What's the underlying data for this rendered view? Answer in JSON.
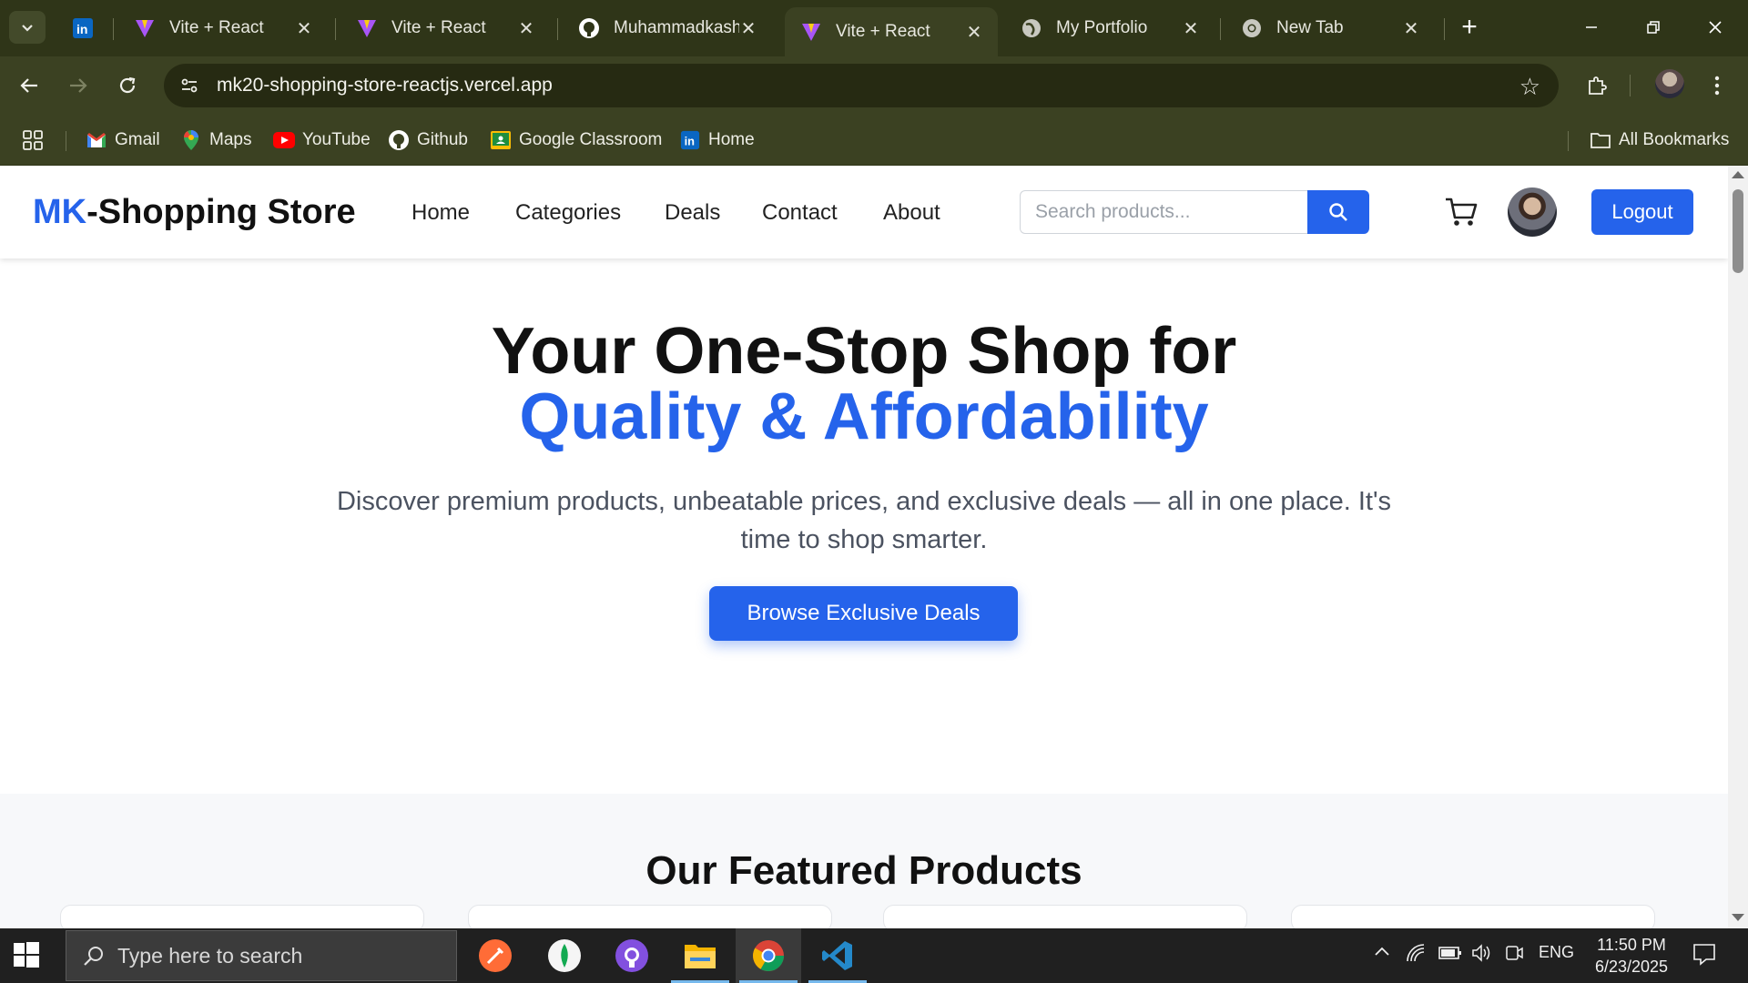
{
  "browser": {
    "tabs": [
      {
        "title": "",
        "icon": "linkedin-icon"
      },
      {
        "title": "Vite + React",
        "icon": "vite-icon"
      },
      {
        "title": "Vite + React",
        "icon": "vite-icon"
      },
      {
        "title": "Muhammadkashi",
        "icon": "github-icon"
      },
      {
        "title": "Vite + React",
        "icon": "vite-icon",
        "active": true
      },
      {
        "title": "My Portfolio",
        "icon": "globe-icon"
      },
      {
        "title": "New Tab",
        "icon": "chrome-icon"
      }
    ],
    "new_tab_label": "+",
    "url": "mk20-shopping-store-reactjs.vercel.app",
    "bookmarks": [
      {
        "label": "Gmail",
        "icon": "gmail-icon"
      },
      {
        "label": "Maps",
        "icon": "maps-icon"
      },
      {
        "label": "YouTube",
        "icon": "youtube-icon"
      },
      {
        "label": "Github",
        "icon": "github-icon"
      },
      {
        "label": "Google Classroom",
        "icon": "classroom-icon"
      },
      {
        "label": "Home",
        "icon": "linkedin-icon"
      }
    ],
    "all_bookmarks_label": "All Bookmarks",
    "colors": {
      "frame": "#2f3518",
      "toolbar": "#3b4122",
      "omnibox": "#262a12"
    }
  },
  "site": {
    "logo_prefix": "MK",
    "logo_rest": "-Shopping Store",
    "nav": [
      "Home",
      "Categories",
      "Deals",
      "Contact",
      "About"
    ],
    "search_placeholder": "Search products...",
    "logout_label": "Logout",
    "accent_color": "#2563eb"
  },
  "hero": {
    "title_line1": "Your One-Stop Shop for",
    "title_line2": "Quality & Affordability",
    "description": "Discover premium products, unbeatable prices, and exclusive deals — all in one place. It's time to shop smarter.",
    "cta_label": "Browse Exclusive Deals"
  },
  "featured": {
    "title": "Our Featured Products"
  },
  "taskbar": {
    "search_placeholder": "Type here to search",
    "apps": [
      "postman-icon",
      "mongodb-compass-icon",
      "github-desktop-icon",
      "file-explorer-icon",
      "chrome-icon",
      "vscode-icon"
    ],
    "language": "ENG",
    "time": "11:50 PM",
    "date": "6/23/2025"
  }
}
